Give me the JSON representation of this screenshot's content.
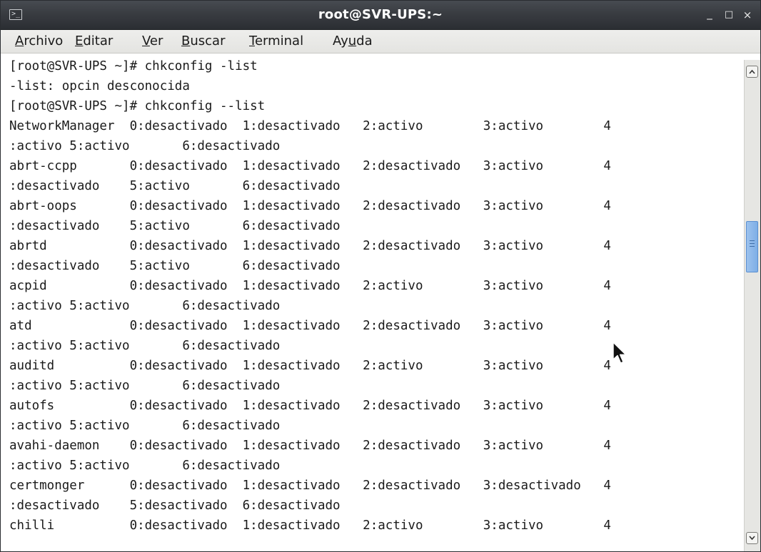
{
  "window": {
    "title": "root@SVR-UPS:~",
    "icon": "terminal-icon",
    "controls": {
      "minimize": "_",
      "maximize": "□",
      "close": "×"
    }
  },
  "menubar": {
    "items": [
      {
        "accel": "A",
        "rest": "rchivo"
      },
      {
        "accel": "E",
        "rest": "ditar"
      },
      {
        "accel": "V",
        "rest": "er"
      },
      {
        "accel": "B",
        "rest": "uscar"
      },
      {
        "accel": "T",
        "rest": "erminal"
      },
      {
        "pre": "Ay",
        "accel": "u",
        "rest": "da"
      }
    ]
  },
  "terminal": {
    "lines": [
      "[root@SVR-UPS ~]# chkconfig -list",
      "-list: opcin desconocida",
      "[root@SVR-UPS ~]# chkconfig --list",
      "NetworkManager  0:desactivado  1:desactivado   2:activo        3:activo        4",
      ":activo 5:activo       6:desactivado",
      "abrt-ccpp       0:desactivado  1:desactivado   2:desactivado   3:activo        4",
      ":desactivado    5:activo       6:desactivado",
      "abrt-oops       0:desactivado  1:desactivado   2:desactivado   3:activo        4",
      ":desactivado    5:activo       6:desactivado",
      "abrtd           0:desactivado  1:desactivado   2:desactivado   3:activo        4",
      ":desactivado    5:activo       6:desactivado",
      "acpid           0:desactivado  1:desactivado   2:activo        3:activo        4",
      ":activo 5:activo       6:desactivado",
      "atd             0:desactivado  1:desactivado   2:desactivado   3:activo        4",
      ":activo 5:activo       6:desactivado",
      "auditd          0:desactivado  1:desactivado   2:activo        3:activo        4",
      ":activo 5:activo       6:desactivado",
      "autofs          0:desactivado  1:desactivado   2:desactivado   3:activo        4",
      ":activo 5:activo       6:desactivado",
      "avahi-daemon    0:desactivado  1:desactivado   2:desactivado   3:activo        4",
      ":activo 5:activo       6:desactivado",
      "certmonger      0:desactivado  1:desactivado   2:desactivado   3:desactivado   4",
      ":desactivado    5:desactivado  6:desactivado",
      "chilli          0:desactivado  1:desactivado   2:activo        3:activo        4"
    ]
  },
  "scrollbar": {
    "position_fraction": 0.35
  }
}
